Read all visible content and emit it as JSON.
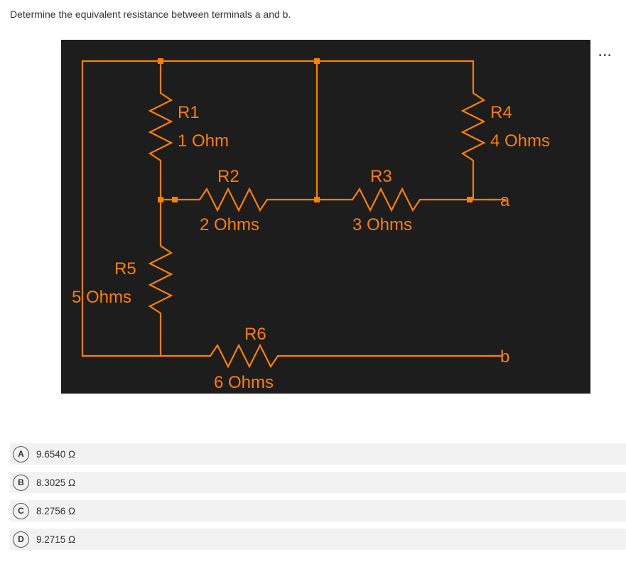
{
  "question": "Determine the equivalent resistance between terminals a and b.",
  "circuit": {
    "r1_label": "R1",
    "r1_value": "1 Ohm",
    "r2_label": "R2",
    "r2_value": "2 Ohms",
    "r3_label": "R3",
    "r3_value": "3 Ohms",
    "r4_label": "R4",
    "r4_value": "4 Ohms",
    "r5_label": "R5",
    "r5_value": "5 Ohms",
    "r6_label": "R6",
    "r6_value": "6 Ohms",
    "node_a": "a",
    "node_b": "b"
  },
  "answers": [
    {
      "letter": "A",
      "text": "9.6540 Ω"
    },
    {
      "letter": "B",
      "text": "8.3025 Ω"
    },
    {
      "letter": "C",
      "text": "8.2756 Ω"
    },
    {
      "letter": "D",
      "text": "9.2715 Ω"
    }
  ],
  "more_icon": "..."
}
